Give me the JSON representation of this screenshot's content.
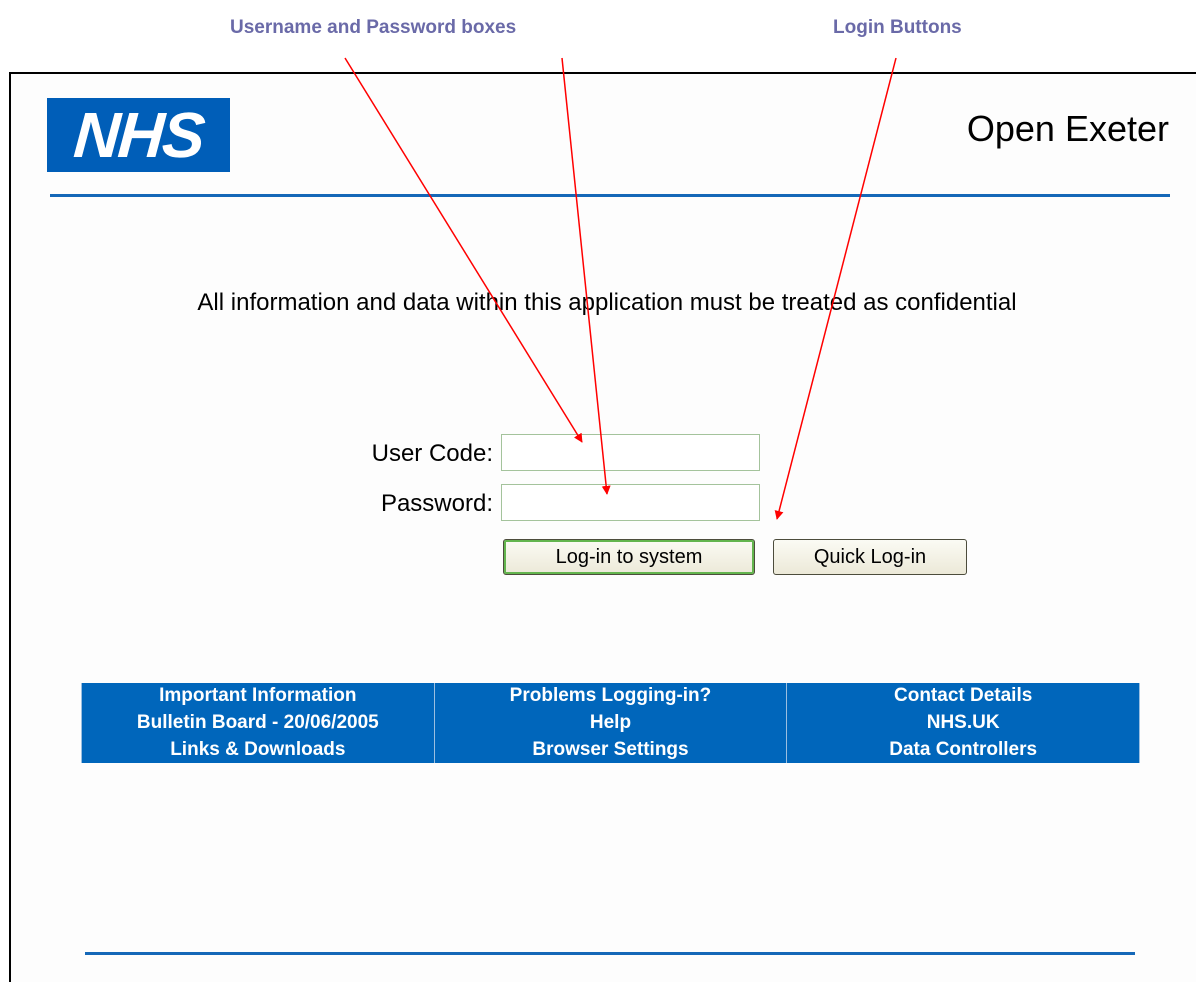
{
  "annotations": {
    "boxes_label": "Username and Password boxes",
    "buttons_label": "Login Buttons",
    "arrow_color": "#ff0000"
  },
  "header": {
    "logo_text": "NHS",
    "logo_color": "#005eb8",
    "app_title": "Open Exeter"
  },
  "notice": "All information and data within this application must be treated as confidential",
  "login_form": {
    "user_code_label": "User Code:",
    "user_code_value": "",
    "password_label": "Password:",
    "password_value": "",
    "login_button": "Log-in to system",
    "quick_login_button": "Quick Log-in"
  },
  "links": [
    [
      "Important Information",
      "Problems Logging-in?",
      "Contact Details"
    ],
    [
      "Bulletin Board - 20/06/2005",
      "Help",
      "NHS.UK"
    ],
    [
      "Links & Downloads",
      "Browser Settings",
      "Data Controllers"
    ]
  ],
  "colors": {
    "rule": "#1568b8",
    "link_bar": "#0066bb",
    "annotation_text": "#6a6aa8"
  }
}
